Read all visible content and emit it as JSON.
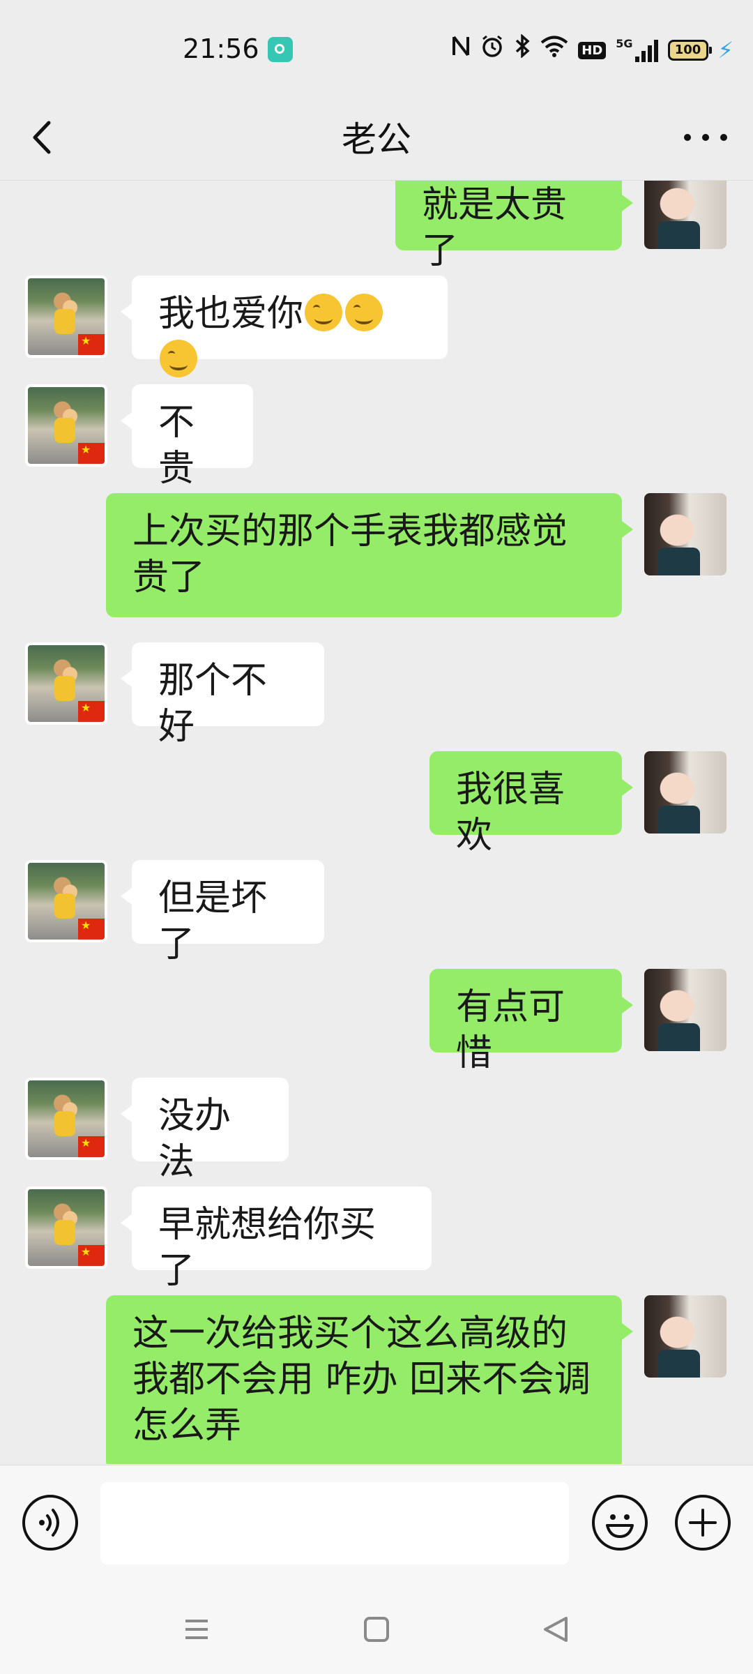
{
  "status_bar": {
    "time": "21:56",
    "network": "5G",
    "hd": "HD",
    "battery": "100"
  },
  "header": {
    "title": "老公"
  },
  "messages": [
    {
      "side": "out",
      "text": "就是太贵了"
    },
    {
      "side": "in",
      "text": "我也爱你",
      "emoji_count": 3
    },
    {
      "side": "in",
      "text": "不贵"
    },
    {
      "side": "out",
      "text": "上次买的那个手表我都感觉贵了"
    },
    {
      "side": "in",
      "text": "那个不好"
    },
    {
      "side": "out",
      "text": "我很喜欢"
    },
    {
      "side": "in",
      "text": "但是坏了"
    },
    {
      "side": "out",
      "text": "有点可惜"
    },
    {
      "side": "in",
      "text": "没办法"
    },
    {
      "side": "in",
      "text": "早就想给你买了"
    },
    {
      "side": "out",
      "text": "这一次给我买个这么高级的 我都不会用 咋办 回来不会调怎么弄"
    }
  ],
  "input": {
    "value": "",
    "placeholder": ""
  },
  "colors": {
    "background": "#ededed",
    "outgoing_bubble": "#95ec69",
    "incoming_bubble": "#ffffff"
  }
}
